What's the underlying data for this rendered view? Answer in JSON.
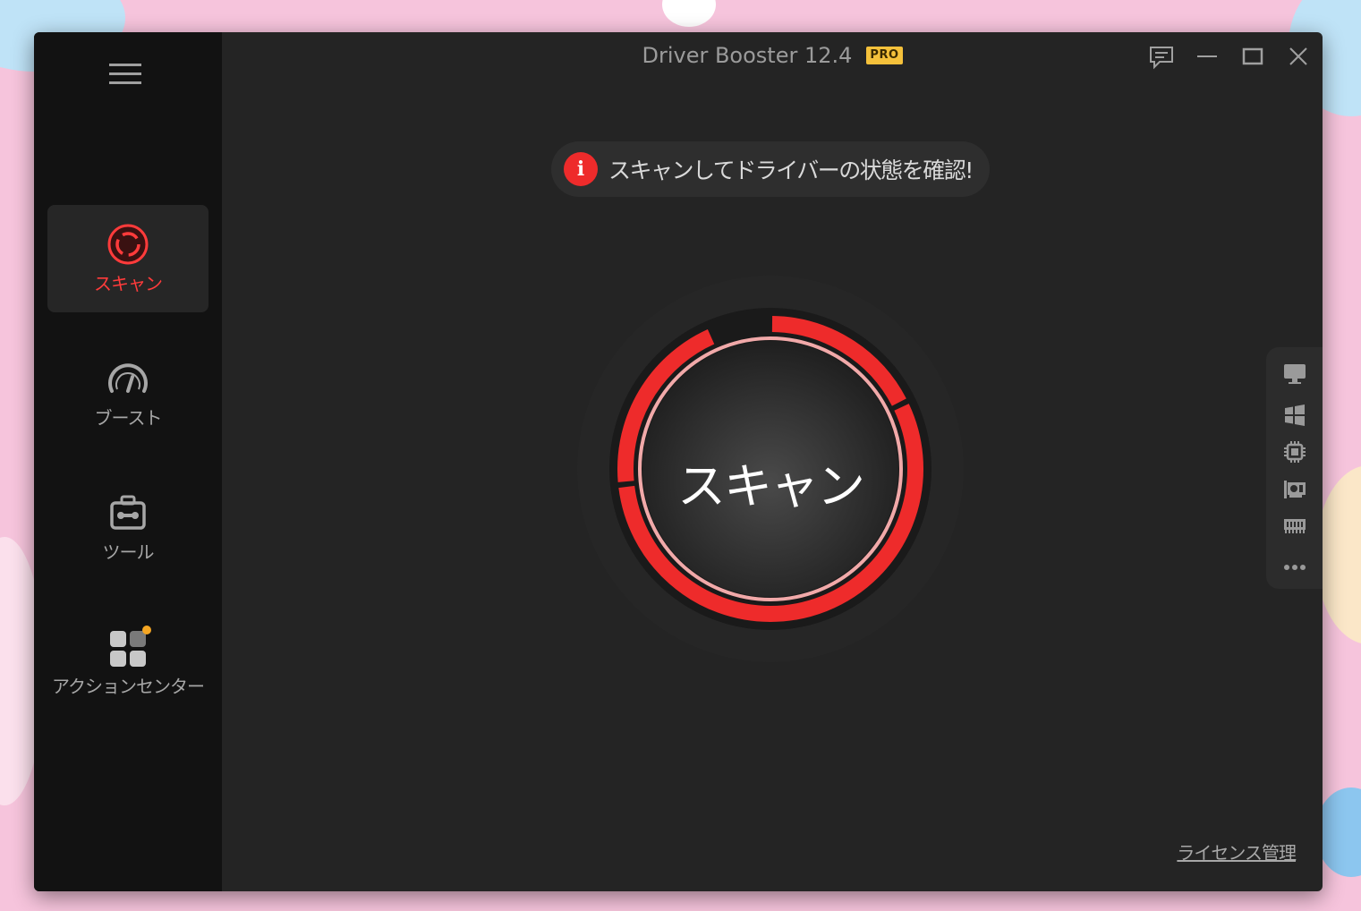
{
  "app": {
    "title": "Driver Booster 12.4",
    "edition_badge": "PRO"
  },
  "colors": {
    "accent_red": "#ee2b2b",
    "sidebar_bg": "#121212",
    "main_bg": "#242424",
    "badge_gold": "#f5c13b"
  },
  "sidebar": {
    "items": [
      {
        "label": "スキャン",
        "icon": "scan-icon",
        "active": true
      },
      {
        "label": "ブースト",
        "icon": "speedometer-icon",
        "active": false
      },
      {
        "label": "ツール",
        "icon": "toolbox-icon",
        "active": false
      },
      {
        "label": "アクションセンター",
        "icon": "apps-grid-icon",
        "active": false,
        "has_notification_dot": true
      }
    ]
  },
  "window_controls": [
    "feedback-icon",
    "minimize-icon",
    "maximize-icon",
    "close-icon"
  ],
  "notice": {
    "icon": "info-icon",
    "icon_glyph": "i",
    "text": "スキャンしてドライバーの状態を確認!"
  },
  "scan_button": {
    "label": "スキャン"
  },
  "right_toolbar": {
    "icons": [
      "monitor-icon",
      "windows-icon",
      "cpu-icon",
      "graphics-card-icon",
      "memory-icon",
      "more-icon"
    ]
  },
  "footer": {
    "license_link": "ライセンス管理"
  }
}
